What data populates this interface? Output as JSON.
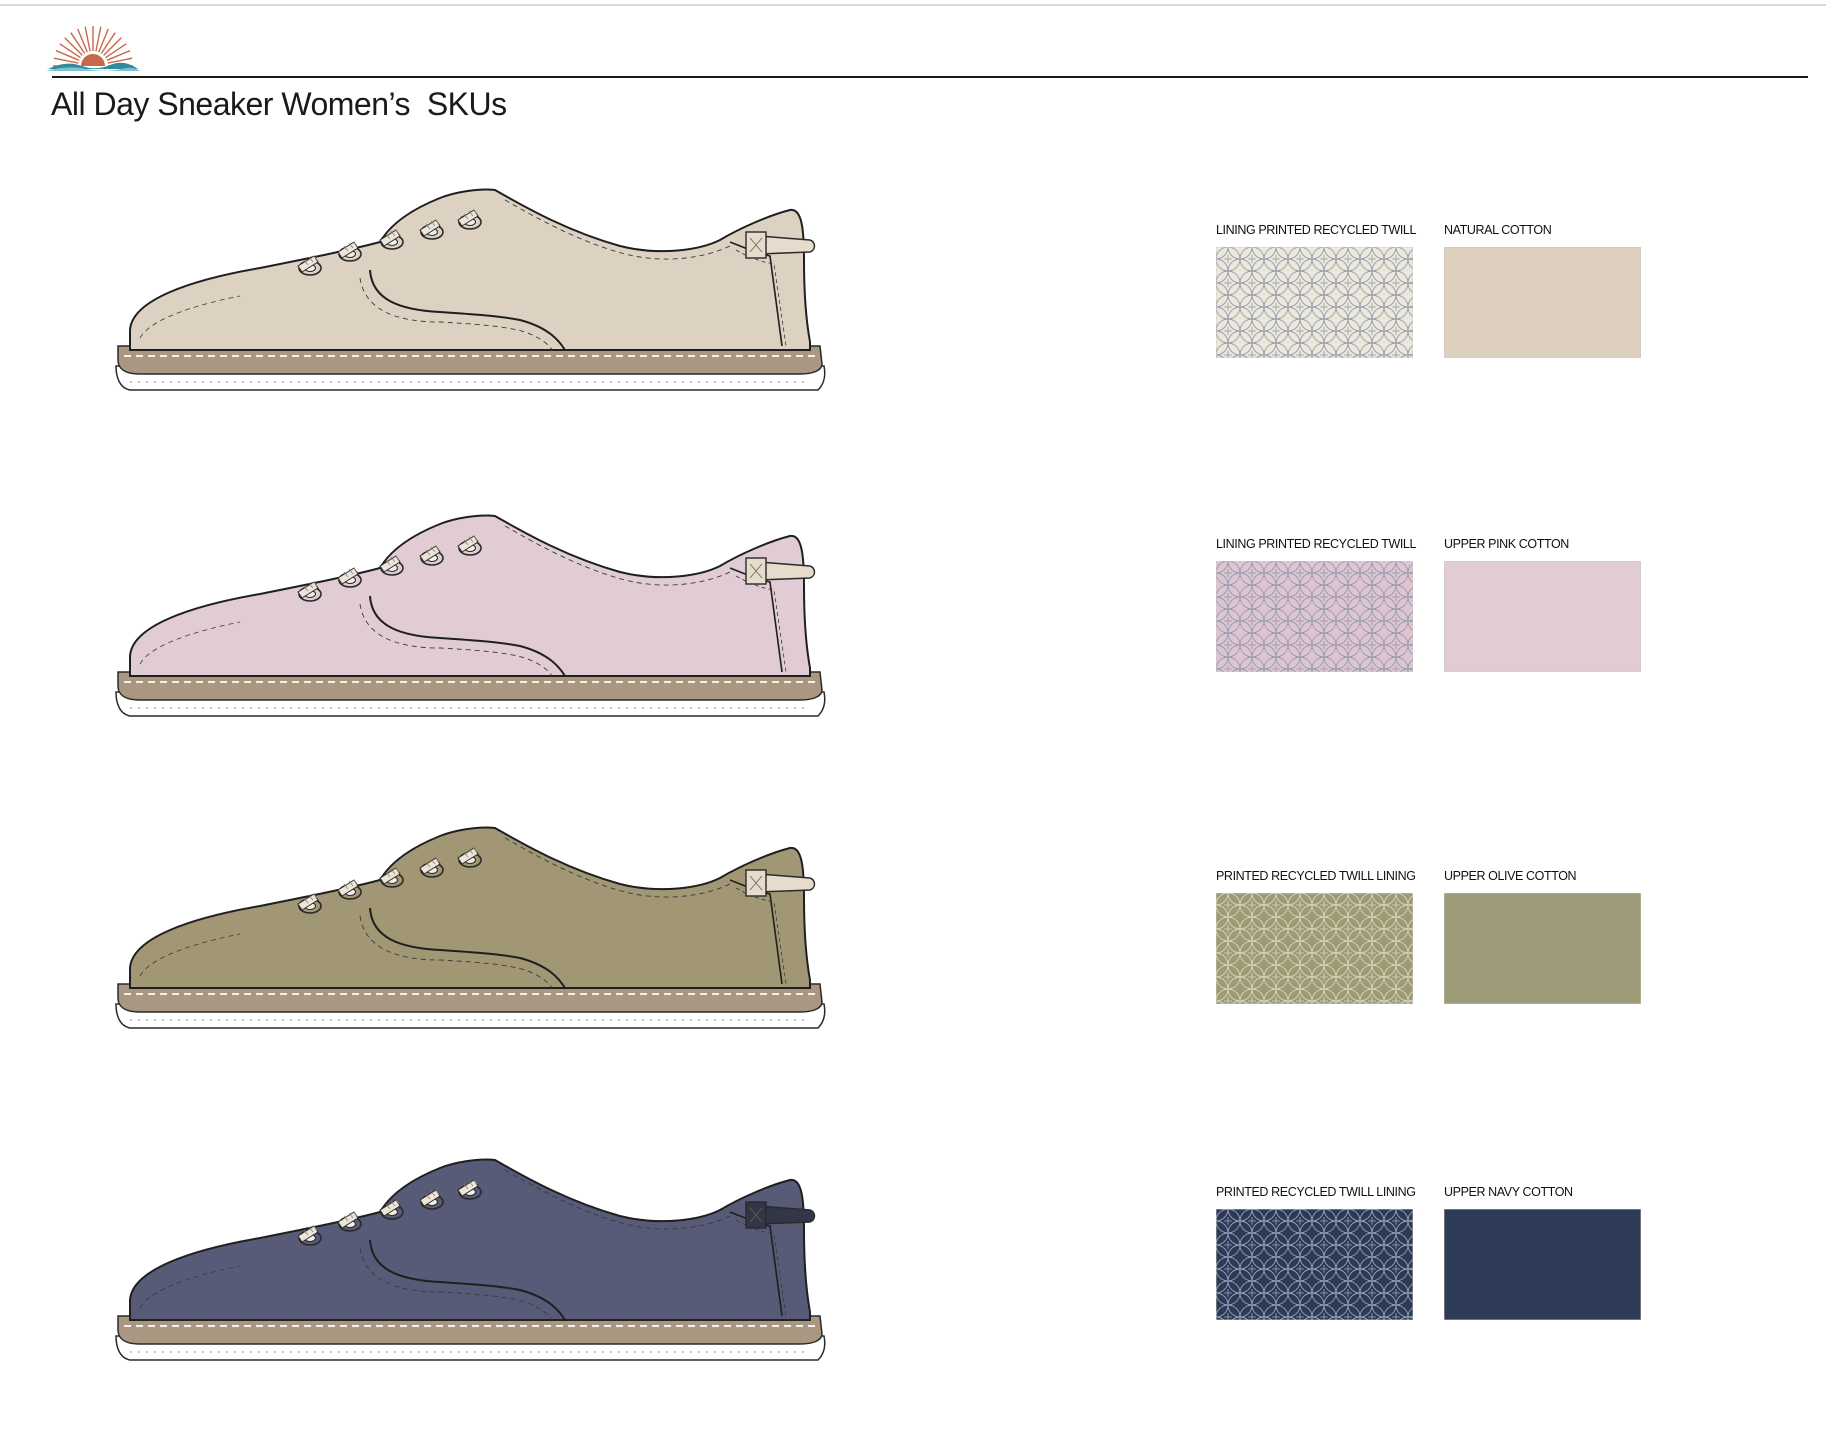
{
  "page": {
    "title": "All Day Sneaker Women’s  SKUs"
  },
  "brand": {
    "logo": "sunrise-over-waves-logo",
    "sun_color": "#c8684a",
    "wave_color": "#2f8aa0",
    "wave_light": "#7fc2cf"
  },
  "skus": [
    {
      "shoe": {
        "upper": "#ddd2c2",
        "sole": "#a99782",
        "heel_tab": "#e6dccd",
        "lace": "#ece5d9"
      },
      "swatches": [
        {
          "label": "LINING PRINTED RECYCLED TWILL",
          "base": "#ece7da",
          "pattern": "#8f9bab",
          "kind": "print"
        },
        {
          "label": "NATURAL COTTON",
          "base": "#ddd0be",
          "kind": "solid"
        }
      ]
    },
    {
      "shoe": {
        "upper": "#e1ccd6",
        "sole": "#a99782",
        "heel_tab": "#e6dccd",
        "lace": "#ece5d9"
      },
      "swatches": [
        {
          "label": "LINING PRINTED RECYCLED TWILL",
          "base": "#dfc5d2",
          "pattern": "#8f9bab",
          "kind": "print"
        },
        {
          "label": "UPPER PINK COTTON",
          "base": "#e1ccd6",
          "kind": "solid"
        }
      ]
    },
    {
      "shoe": {
        "upper": "#a19774",
        "sole": "#a99782",
        "heel_tab": "#e6dccd",
        "lace": "#ece5d9"
      },
      "swatches": [
        {
          "label": "PRINTED RECYCLED TWILL LINING",
          "base": "#9d9a74",
          "pattern": "#d8d8c4",
          "kind": "print"
        },
        {
          "label": "UPPER OLIVE COTTON",
          "base": "#9d9a77",
          "kind": "solid"
        }
      ]
    },
    {
      "shoe": {
        "upper": "#575b78",
        "sole": "#a99782",
        "heel_tab": "#333648",
        "lace": "#ece5d9"
      },
      "swatches": [
        {
          "label": "PRINTED RECYCLED TWILL LINING",
          "base": "#2d3a55",
          "pattern": "#9aa6bd",
          "kind": "print"
        },
        {
          "label": "UPPER NAVY COTTON",
          "base": "#2e3b56",
          "kind": "solid"
        }
      ]
    }
  ]
}
